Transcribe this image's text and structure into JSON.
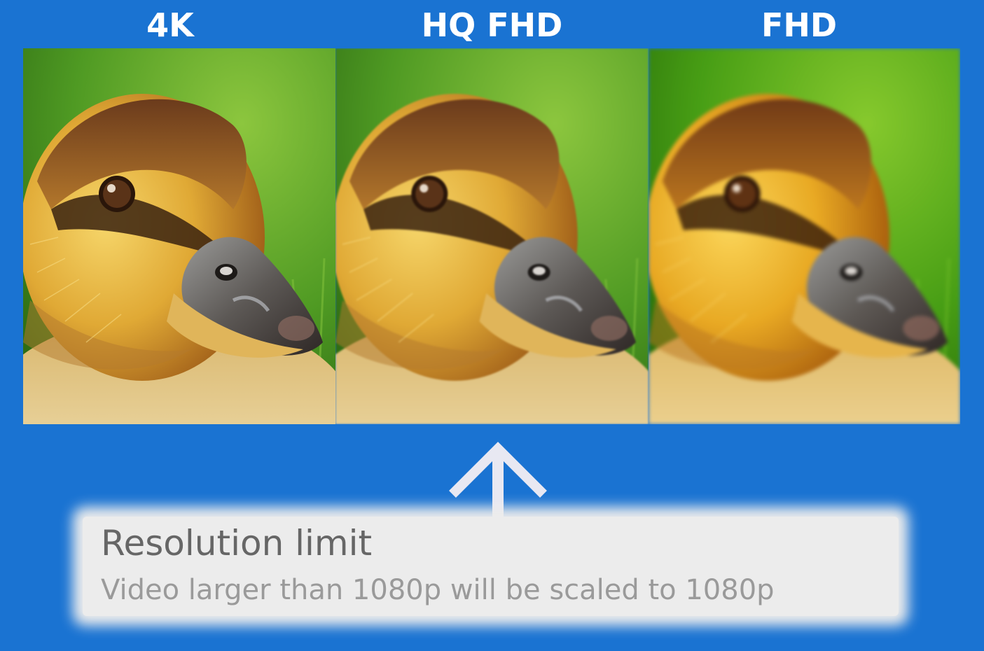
{
  "labels": {
    "left": "4K",
    "middle": "HQ FHD",
    "right": "FHD"
  },
  "images": {
    "subject": "duckling close-up",
    "icon": "duckling-photo"
  },
  "card": {
    "title": "Resolution limit",
    "subtitle": "Video larger than 1080p will be scaled to 1080p"
  },
  "colors": {
    "background": "#1a73d2",
    "card": "#ececec",
    "arrow": "#e8e8f2"
  }
}
